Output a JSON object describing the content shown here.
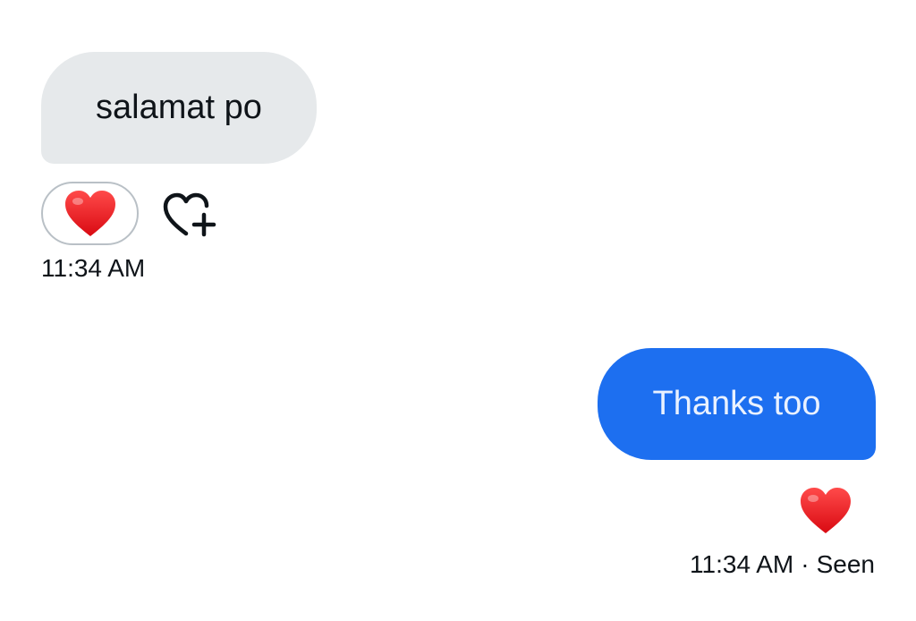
{
  "conversation": {
    "received_message": {
      "text": "salamat po",
      "reaction_icon": "red-heart-icon",
      "add_reaction_icon": "heart-plus-icon",
      "timestamp": "11:34 AM"
    },
    "sent_message": {
      "text": "Thanks too",
      "reaction_icon": "red-heart-icon",
      "timestamp": "11:34 AM",
      "separator": "·",
      "status": "Seen"
    }
  },
  "colors": {
    "received_bubble": "#e6e9eb",
    "sent_bubble": "#1d6ff0",
    "heart": "#e8131b",
    "text": "#0f1419"
  }
}
